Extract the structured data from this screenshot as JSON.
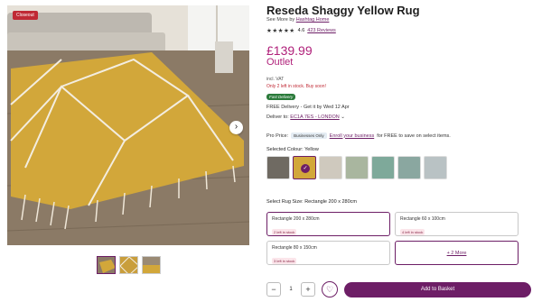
{
  "gallery": {
    "badge": "Closeout",
    "next_arrow": "›",
    "thumbnail_count": 3
  },
  "product": {
    "title": "Reseda Shaggy Yellow Rug",
    "brand_prefix": "See More by ",
    "brand": "Hashtag Home",
    "stars": "★★★★★",
    "rating": "4.6",
    "reviews": "423 Reviews",
    "price": "£139.99",
    "outlet": "Outlet",
    "vat": "incl. VAT",
    "stock_warning": "Only 2 left in stock. Buy soon!",
    "fast_delivery": "Fast Delivery",
    "delivery": "FREE Delivery - Get it by Wed 12 Apr",
    "deliver_to_label": "Deliver to:",
    "deliver_to": "EC1A 7ES - LONDON",
    "pro_price_label": "Pro Price:",
    "businesses_only": "Businesses Only",
    "enroll_link": "Enroll your business",
    "enroll_suffix": "for FREE to save on select items."
  },
  "colour": {
    "label": "Selected Colour:",
    "value": "Yellow",
    "swatch_colors": [
      "#6f6a62",
      "#d2a73a",
      "#cfc9be",
      "#a9b69f",
      "#7ea99a",
      "#8aa7a0",
      "#b9c2c4"
    ]
  },
  "size": {
    "label": "Select Rug Size:",
    "value": "Rectangle 200 x 280cm",
    "options": [
      {
        "name": "Rectangle 200 x 280cm",
        "stock": "2 left in stock"
      },
      {
        "name": "Rectangle 60 x 100cm",
        "stock": "4 left in stock"
      },
      {
        "name": "Rectangle 80 x 150cm",
        "stock": "3 left in stock"
      }
    ],
    "more": "+ 2 More"
  },
  "buy": {
    "minus": "−",
    "qty": "1",
    "plus": "+",
    "wishlist": "♡",
    "add_to_basket": "Add to Basket"
  },
  "colors": {
    "accent": "#6d1e66",
    "price": "#b0207a",
    "rug": "#d2a73a"
  }
}
